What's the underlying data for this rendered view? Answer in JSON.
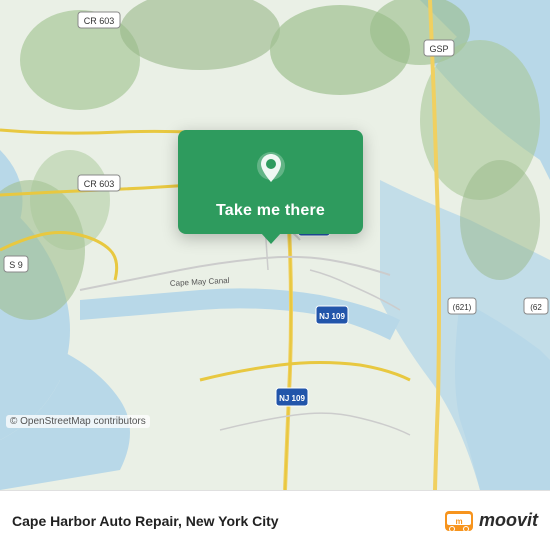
{
  "map": {
    "attribution": "© OpenStreetMap contributors",
    "background_color": "#e8f0e0"
  },
  "card": {
    "label": "Take me there",
    "pin_icon": "location-pin"
  },
  "bottom_bar": {
    "place_name": "Cape Harbor Auto Repair, New York City",
    "moovit_label": "moovit"
  }
}
